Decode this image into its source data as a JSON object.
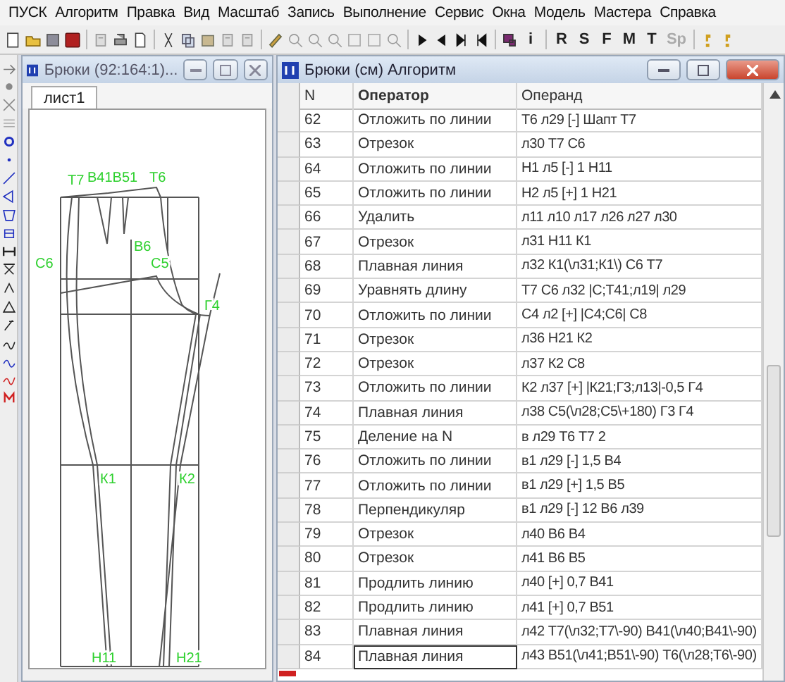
{
  "menu": [
    "ПУСК",
    "Алгоритм",
    "Правка",
    "Вид",
    "Масштаб",
    "Запись",
    "Выполнение",
    "Сервис",
    "Окна",
    "Модель",
    "Мастера",
    "Справка"
  ],
  "toolbar": {
    "info_button": "i",
    "letter_buttons": [
      "R",
      "S",
      "F",
      "M",
      "T",
      "Sp"
    ]
  },
  "drawing_window": {
    "title": "Брюки (92:164:1)...",
    "tab": "лист1",
    "point_labels": [
      "Т7",
      "В41В51",
      "Т6",
      "В6",
      "С6",
      "С5",
      "Г4",
      "К1",
      "К2",
      "Н11",
      "Н21"
    ]
  },
  "algorithm_window": {
    "title": "Брюки (см) Алгоритм",
    "columns": [
      "N",
      "Оператор",
      "Операнд"
    ],
    "rows": [
      {
        "n": "62",
        "operator": "Отложить по линии",
        "operand": "Т6 л29 [-] Шапт Т7",
        "selected": false
      },
      {
        "n": "63",
        "operator": "Отрезок",
        "operand": "л30 Т7 С6",
        "selected": false
      },
      {
        "n": "64",
        "operator": "Отложить по линии",
        "operand": "Н1 л5 [-] 1 Н11",
        "selected": false
      },
      {
        "n": "65",
        "operator": "Отложить по линии",
        "operand": "Н2 л5 [+] 1 Н21",
        "selected": false
      },
      {
        "n": "66",
        "operator": "Удалить",
        "operand": "л11 л10 л17 л26 л27 л30",
        "selected": false
      },
      {
        "n": "67",
        "operator": "Отрезок",
        "operand": "л31 Н11 К1",
        "selected": false
      },
      {
        "n": "68",
        "operator": "Плавная линия",
        "operand": "л32 К1(\\л31;К1\\) С6 Т7",
        "selected": false
      },
      {
        "n": "69",
        "operator": "Уравнять длину",
        "operand": "Т7 С6 л32 |С;Т41;л19| л29",
        "selected": false
      },
      {
        "n": "70",
        "operator": "Отложить по линии",
        "operand": "С4 л2 [+] |С4;С6| С8",
        "selected": false
      },
      {
        "n": "71",
        "operator": "Отрезок",
        "operand": "л36 Н21 К2",
        "selected": false
      },
      {
        "n": "72",
        "operator": "Отрезок",
        "operand": "л37 К2 С8",
        "selected": false
      },
      {
        "n": "73",
        "operator": "Отложить по линии",
        "operand": "К2 л37 [+] |К21;Г3;л13|-0,5 Г4",
        "selected": false
      },
      {
        "n": "74",
        "operator": "Плавная линия",
        "operand": "л38 С5(\\л28;С5\\+180) Г3 Г4",
        "selected": false
      },
      {
        "n": "75",
        "operator": "Деление на N",
        "operand": "в л29 Т6 Т7 2",
        "selected": false
      },
      {
        "n": "76",
        "operator": "Отложить по линии",
        "operand": "в1 л29 [-] 1,5 В4",
        "selected": false
      },
      {
        "n": "77",
        "operator": "Отложить по линии",
        "operand": "в1 л29 [+] 1,5 В5",
        "selected": false
      },
      {
        "n": "78",
        "operator": "Перпендикуляр",
        "operand": "в1 л29 [-] 12 В6 л39",
        "selected": false
      },
      {
        "n": "79",
        "operator": "Отрезок",
        "operand": "л40 В6 В4",
        "selected": false
      },
      {
        "n": "80",
        "operator": "Отрезок",
        "operand": "л41 В6 В5",
        "selected": false
      },
      {
        "n": "81",
        "operator": "Продлить линию",
        "operand": "л40 [+] 0,7 В41",
        "selected": false
      },
      {
        "n": "82",
        "operator": "Продлить линию",
        "operand": "л41 [+] 0,7 В51",
        "selected": false
      },
      {
        "n": "83",
        "operator": "Плавная линия",
        "operand": "л42 Т7(\\л32;Т7\\-90) В41(\\л40;В41\\-90)",
        "selected": false
      },
      {
        "n": "84",
        "operator": "Плавная линия",
        "operand": "л43 В51(\\л41;В51\\-90) Т6(\\л28;Т6\\-90)",
        "selected": true
      }
    ]
  }
}
